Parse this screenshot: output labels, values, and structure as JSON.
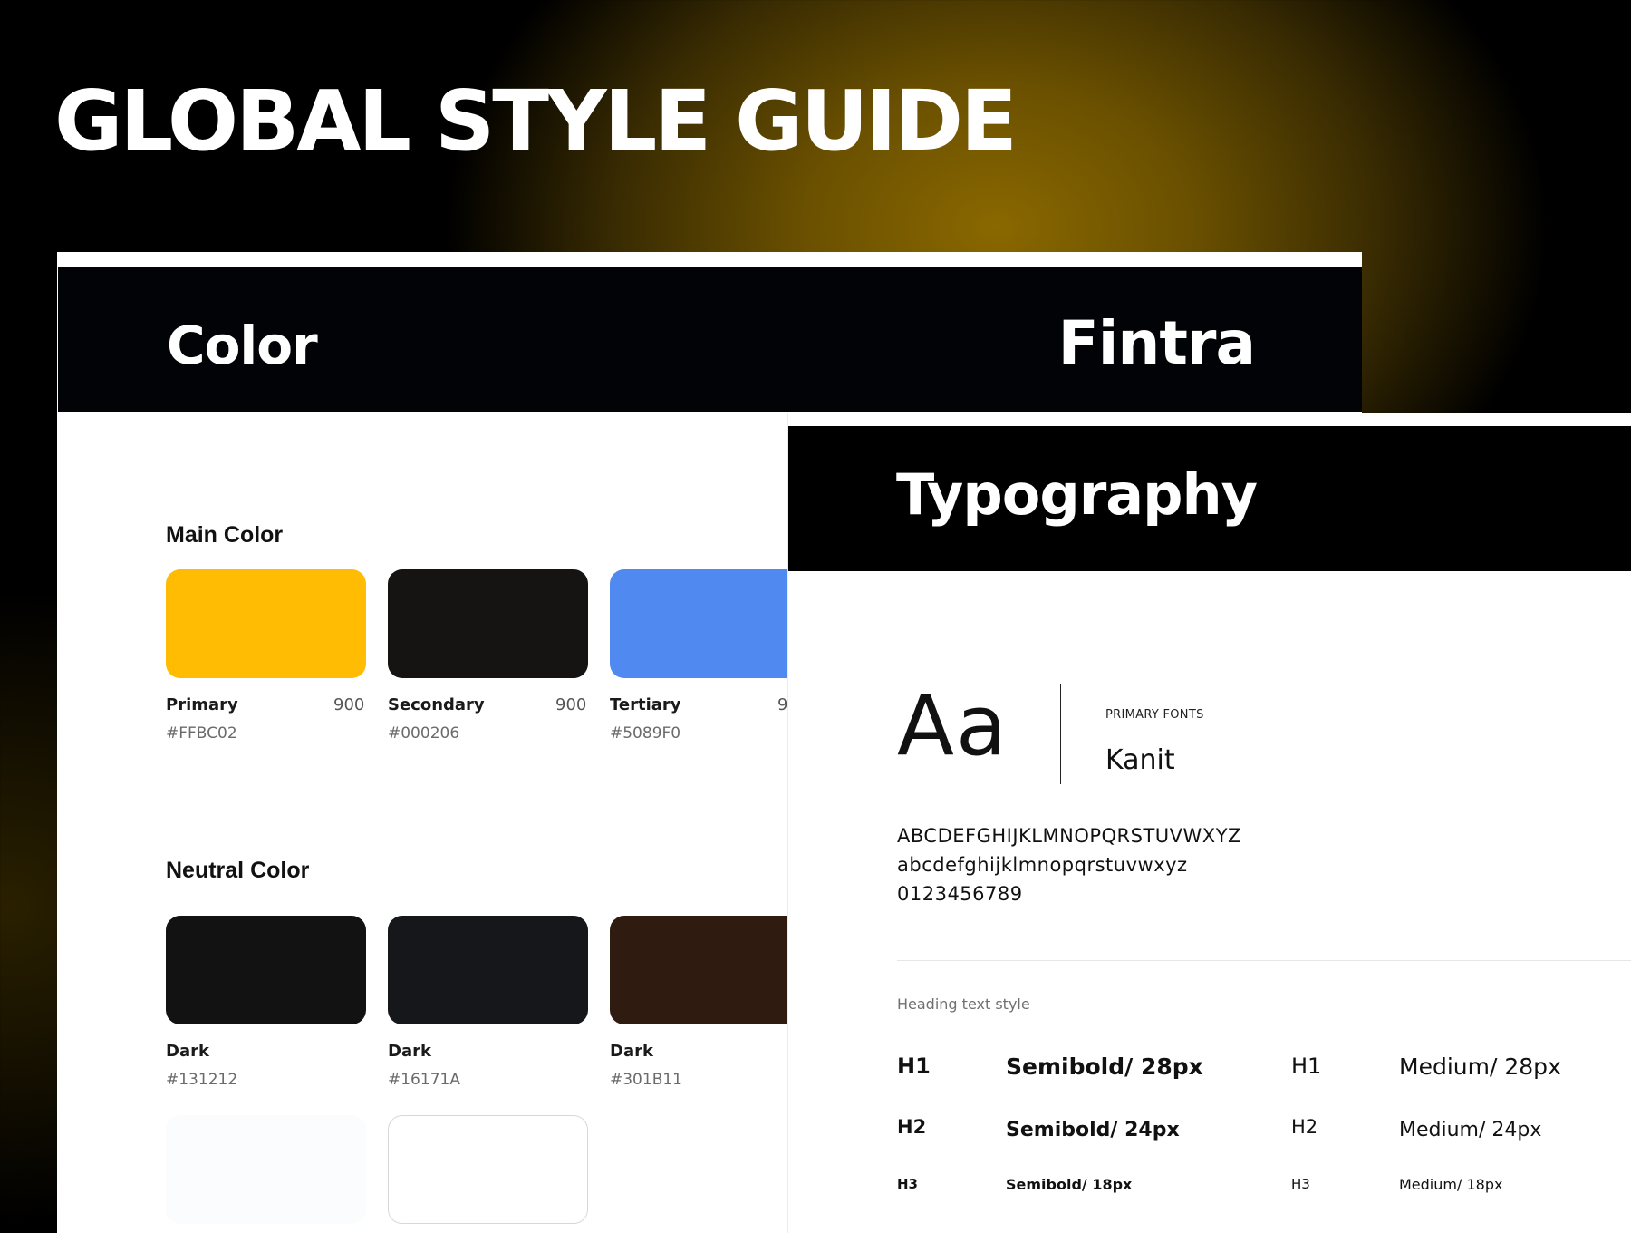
{
  "page": {
    "title": "GLOBAL STYLE GUIDE"
  },
  "color_card": {
    "title": "Color",
    "brand": "Fintra",
    "main_section_title": "Main Color",
    "main_colors": [
      {
        "name": "Primary",
        "shade": "900",
        "hex": "#FFBC02",
        "color": "#FFBC02"
      },
      {
        "name": "Secondary",
        "shade": "900",
        "hex": "#000206",
        "color": "#151412"
      },
      {
        "name": "Tertiary",
        "shade": "9",
        "hex": "#5089F0",
        "color": "#5089F0"
      }
    ],
    "neutral_section_title": "Neutral Color",
    "neutral_colors": [
      {
        "name": "Dark",
        "hex": "#131212",
        "color": "#131212"
      },
      {
        "name": "Dark",
        "hex": "#16171A",
        "color": "#16171A"
      },
      {
        "name": "Dark",
        "hex": "#301B11",
        "color": "#301B11"
      }
    ],
    "light_colors": [
      {
        "color": "#FBFCFE"
      },
      {
        "color": "#FFFFFF"
      }
    ]
  },
  "typography_card": {
    "title": "Typography",
    "sample": "Aa",
    "font_label": "PRIMARY FONTS",
    "font_name": "Kanit",
    "uppercase": "ABCDEFGHIJKLMNOPQRSTUVWXYZ",
    "lowercase": "abcdefghijklmnopqrstuvwxyz",
    "digits": "0123456789",
    "heading_caption": "Heading text style",
    "headings": [
      {
        "tag": "H1",
        "semibold": "Semibold/ 28px",
        "medium": "Medium/ 28px"
      },
      {
        "tag": "H2",
        "semibold": "Semibold/ 24px",
        "medium": "Medium/ 24px"
      },
      {
        "tag": "H3",
        "semibold": "Semibold/ 18px",
        "medium": "Medium/ 18px"
      }
    ]
  }
}
